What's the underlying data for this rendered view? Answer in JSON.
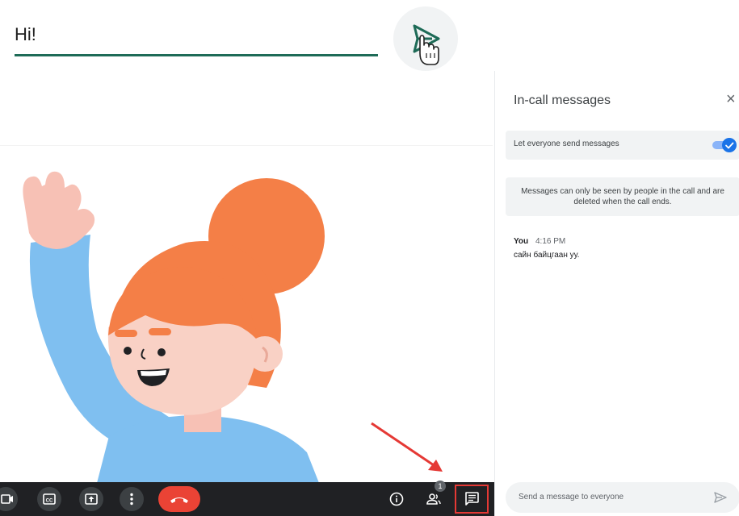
{
  "composer_top": {
    "value": "Hi!"
  },
  "panel": {
    "title": "In-call messages",
    "close_glyph": "×",
    "toggle_label": "Let everyone send messages",
    "toggle_on": true,
    "notice": "Messages can only be seen by people in the call and are deleted when the call ends.",
    "message": {
      "sender": "You",
      "time": "4:16 PM",
      "text": "сайн байцгаан уу."
    },
    "composer_placeholder": "Send a message to everyone"
  },
  "controls": {
    "people_count": "1"
  },
  "icons": [
    "send-icon",
    "hand-cursor-icon",
    "camera-icon",
    "captions-icon",
    "present-icon",
    "more-vert-icon",
    "end-call-icon",
    "info-icon",
    "people-icon",
    "chat-icon",
    "close-icon",
    "check-icon"
  ],
  "colors": {
    "accent": "#1a73e8",
    "underline": "#1e6b57",
    "end_call": "#ea4335",
    "highlight": "#e53935",
    "bar": "#202124"
  }
}
